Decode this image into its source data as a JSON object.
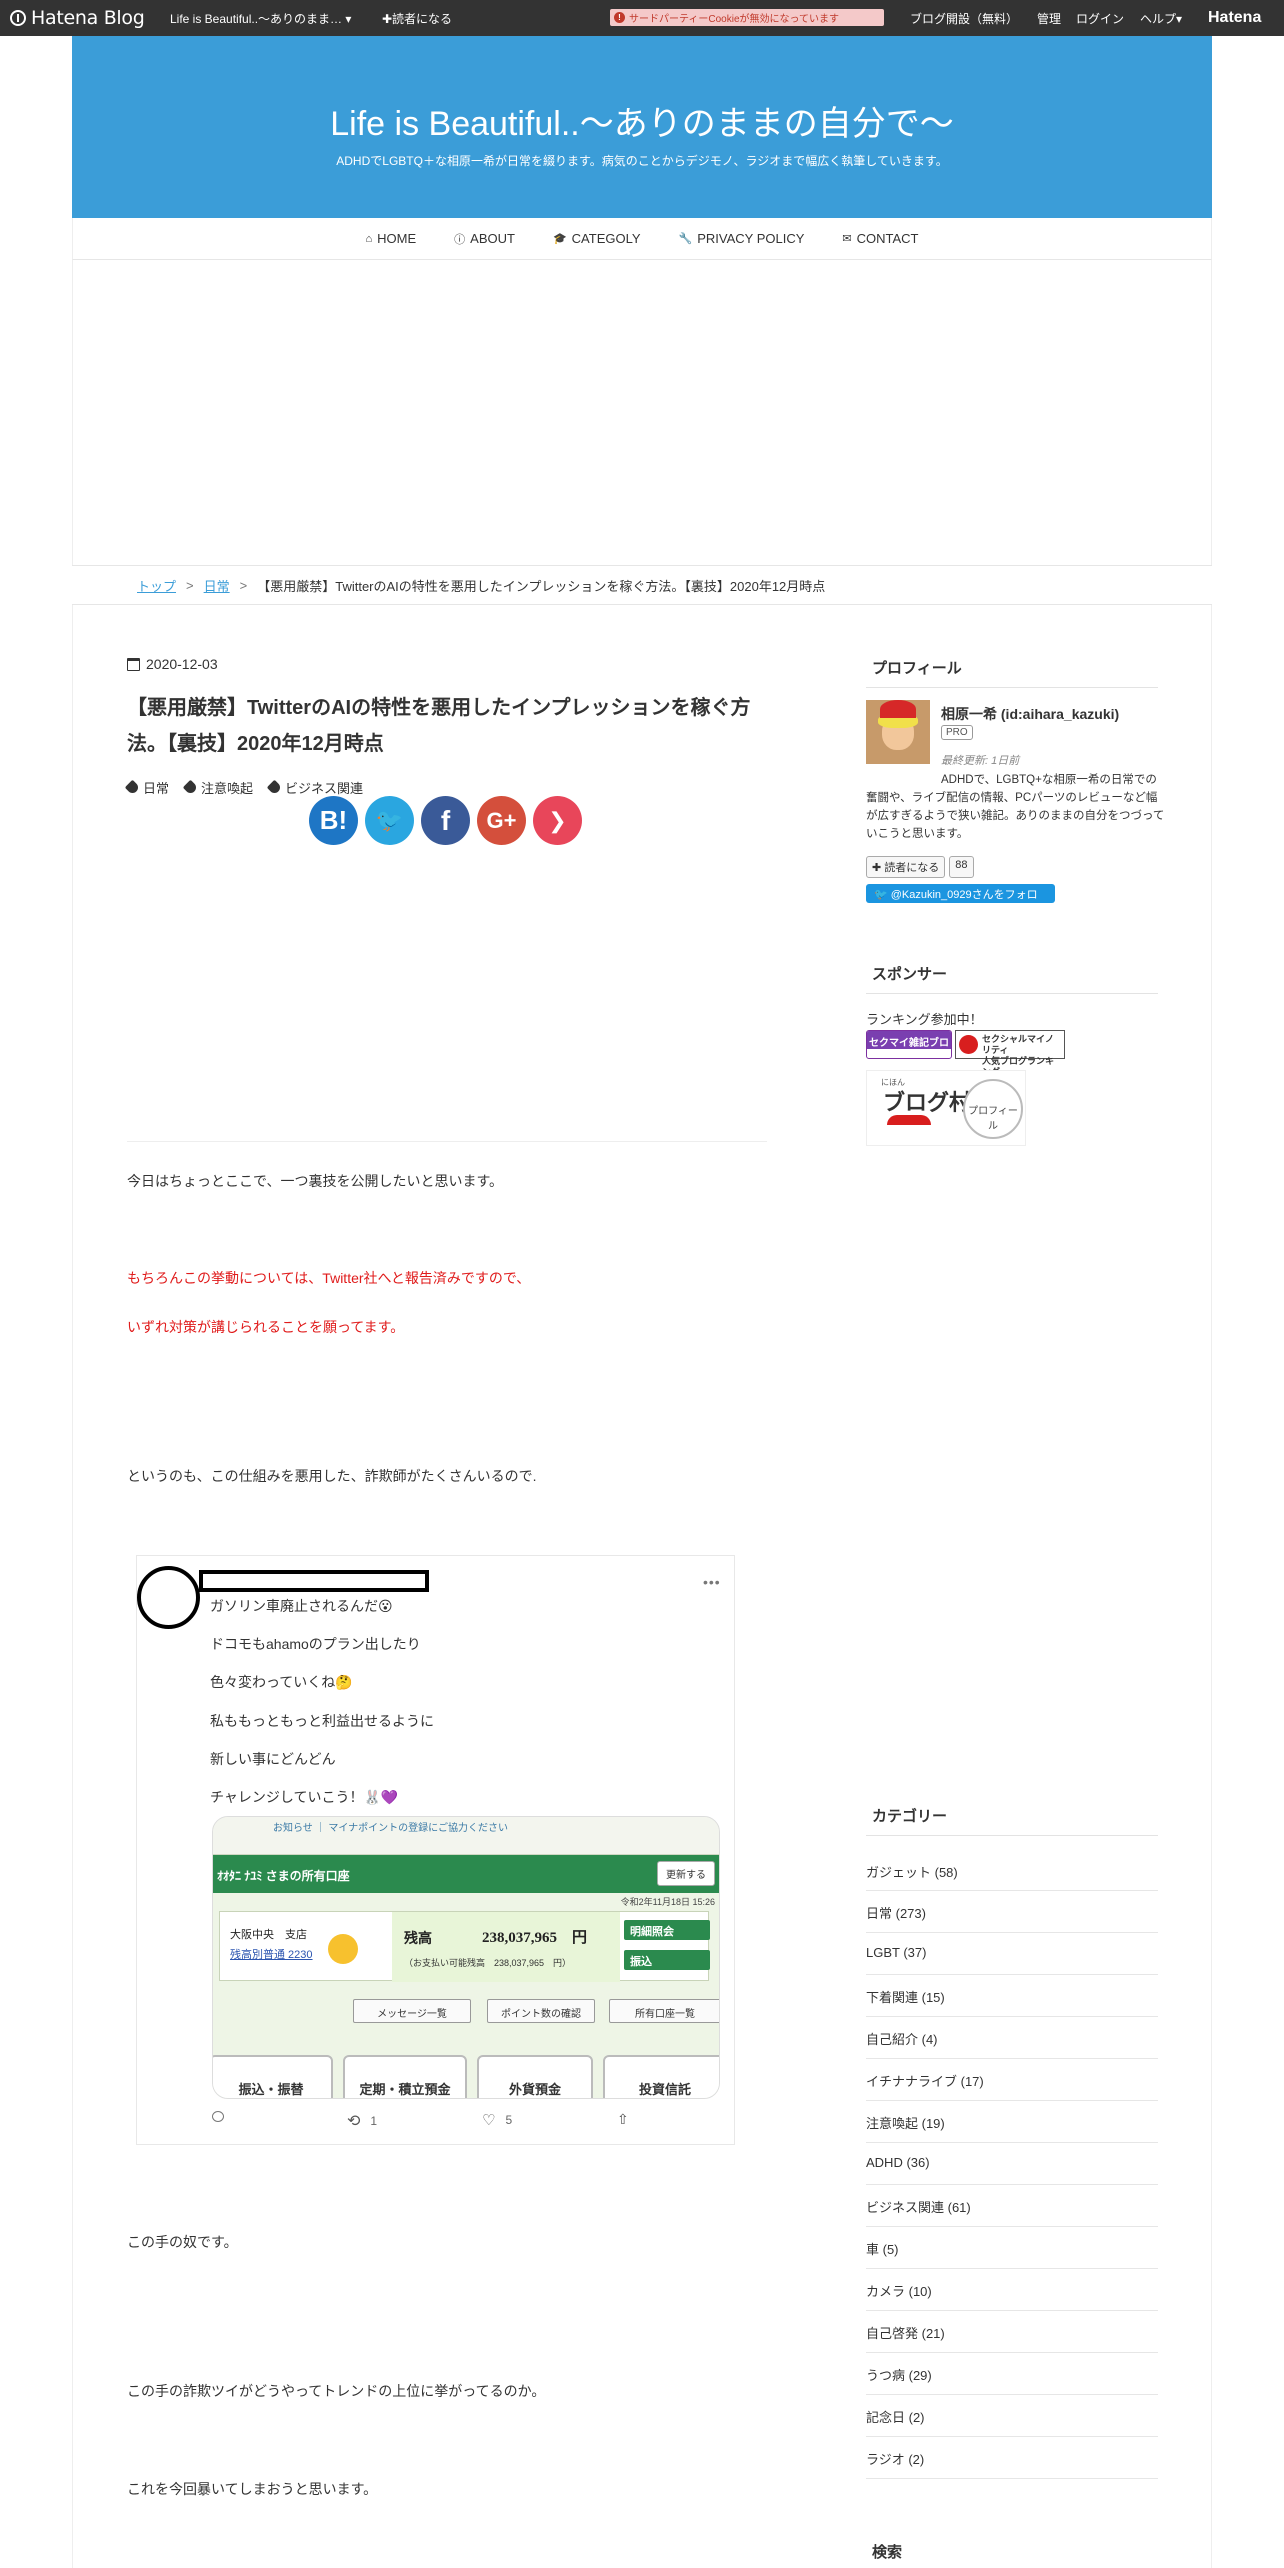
{
  "topbar": {
    "logo": "Hatena Blog",
    "blog_selector": "Life is Beautiful..～ありのまま… ▾",
    "reader": "✚読者になる",
    "cookie_notice": "サードパーティーCookieが無効になっています",
    "links": [
      "ブログ開設（無料）",
      "管理",
      "ログイン",
      "ヘルプ▾"
    ],
    "brand": "Hatena"
  },
  "header": {
    "title": "Life is Beautiful..～ありのままの自分で～",
    "description": "ADHDでLGBTQ＋な相原一希が日常を綴ります。病気のことからデジモノ、ラジオまで幅広く執筆していきます。",
    "bg_color": "#3b9dd8"
  },
  "nav": [
    {
      "icon": "home-icon",
      "glyph": "⌂",
      "label": "HOME"
    },
    {
      "icon": "info-icon",
      "glyph": "ⓘ",
      "label": "ABOUT"
    },
    {
      "icon": "graduation-cap-icon",
      "glyph": "🎓",
      "label": "CATEGOLY"
    },
    {
      "icon": "wrench-icon",
      "glyph": "🔧",
      "label": "PRIVACY POLICY"
    },
    {
      "icon": "envelope-icon",
      "glyph": "✉",
      "label": "CONTACT"
    }
  ],
  "breadcrumb": {
    "home": "トップ",
    "sep": ">",
    "category": "日常",
    "current": "【悪用厳禁】TwitterのAIの特性を悪用したインプレッションを稼ぐ方法。【裏技】2020年12月時点"
  },
  "article": {
    "date": "2020-12-03",
    "title": "【悪用厳禁】TwitterのAIの特性を悪用したインプレッションを稼ぐ方法。【裏技】2020年12月時点",
    "categories": [
      "日常",
      "注意喚起",
      "ビジネス関連"
    ],
    "share": {
      "hatena": "B!",
      "twitter": "🐦",
      "facebook": "f",
      "gplus": "G+",
      "pocket": "❯"
    },
    "paragraphs": {
      "p1": "今日はちょっとここで、一つ裏技を公開したいと思います。",
      "p2": "もちろんこの挙動については、Twitter社へと報告済みですので、",
      "p3": "いずれ対策が講じられることを願ってます。",
      "p4": "というのも、この仕組みを悪用した、詐欺師がたくさんいるので.",
      "p5": "この手の奴です。",
      "p6": "この手の詐欺ツイがどうやってトレンドの上位に挙がってるのか。",
      "p7": "これを今回暴いてしまおうと思います。"
    }
  },
  "tweet": {
    "more": "•••",
    "lines": [
      "ガソリン車廃止されるんだ😮",
      "ドコモもahamoのプラン出したり",
      "色々変わっていくね🤔",
      "私ももっともっと利益出せるように",
      "新しい事にどんどん",
      "チャレンジしていこう！🐰💜"
    ],
    "image": {
      "notice": "お知らせ",
      "notice_link": "マイナポイントの登録にご協力ください",
      "header": "ｵｵﾀﾆ ﾅﾕﾐ さまの所有口座",
      "refresh": "更新する",
      "timestamp": "令和2年11月18日 15:26",
      "branch": "大阪中央　支店",
      "account": "残高別普通 2230",
      "balance_label": "残高",
      "balance": "238,037,965　円",
      "available": "（お支払い可能残高　238,037,965　円）",
      "buttons_right": [
        "明細照会",
        "振込"
      ],
      "buttons_row": [
        "メッセージ一覧",
        "ポイント数の確認",
        "所有口座一覧"
      ],
      "big_buttons": [
        "振込・振替",
        "定期・積立預金",
        "外貨預金",
        "投資信託"
      ]
    },
    "actions": {
      "retweets": "1",
      "likes": "5"
    }
  },
  "sidebar": {
    "profile_head": "プロフィール",
    "name": "相原一希 (id:aihara_kazuki)",
    "pro": "PRO",
    "last_update": "最終更新: 1日前",
    "description": "ADHDで、LGBTQ+な相原一希の日常での奮闘や、ライブ配信の情報、PCパーツのレビューなど幅が広すぎるようで狭い雑記。ありのままの自分をつづっていこうと思います。",
    "reader_btn": "✚ 読者になる",
    "reader_count": "88",
    "twitter_follow": "🐦 @Kazukin_0929さんをフォロー",
    "sponsor_head": "スポンサー",
    "ranking": "ランキング参加中！",
    "banner1": "セクマイ雑記ブログ",
    "banner2_line1": "セクシャルマイノリティ",
    "banner2_line2": "人気ブログランキング",
    "banner3_title": "ブログ村",
    "banner3_small": "にほん",
    "banner3_circle": "プロフィール",
    "category_head": "カテゴリー",
    "categories": [
      "ガジェット (58)",
      "日常 (273)",
      "LGBT (37)",
      "下着関連 (15)",
      "自己紹介 (4)",
      "イチナナライブ (17)",
      "注意喚起 (19)",
      "ADHD (36)",
      "ビジネス関連 (61)",
      "車 (5)",
      "カメラ (10)",
      "自己啓発 (21)",
      "うつ病 (29)",
      "記念日 (2)",
      "ラジオ (2)"
    ],
    "search_head": "検索"
  }
}
